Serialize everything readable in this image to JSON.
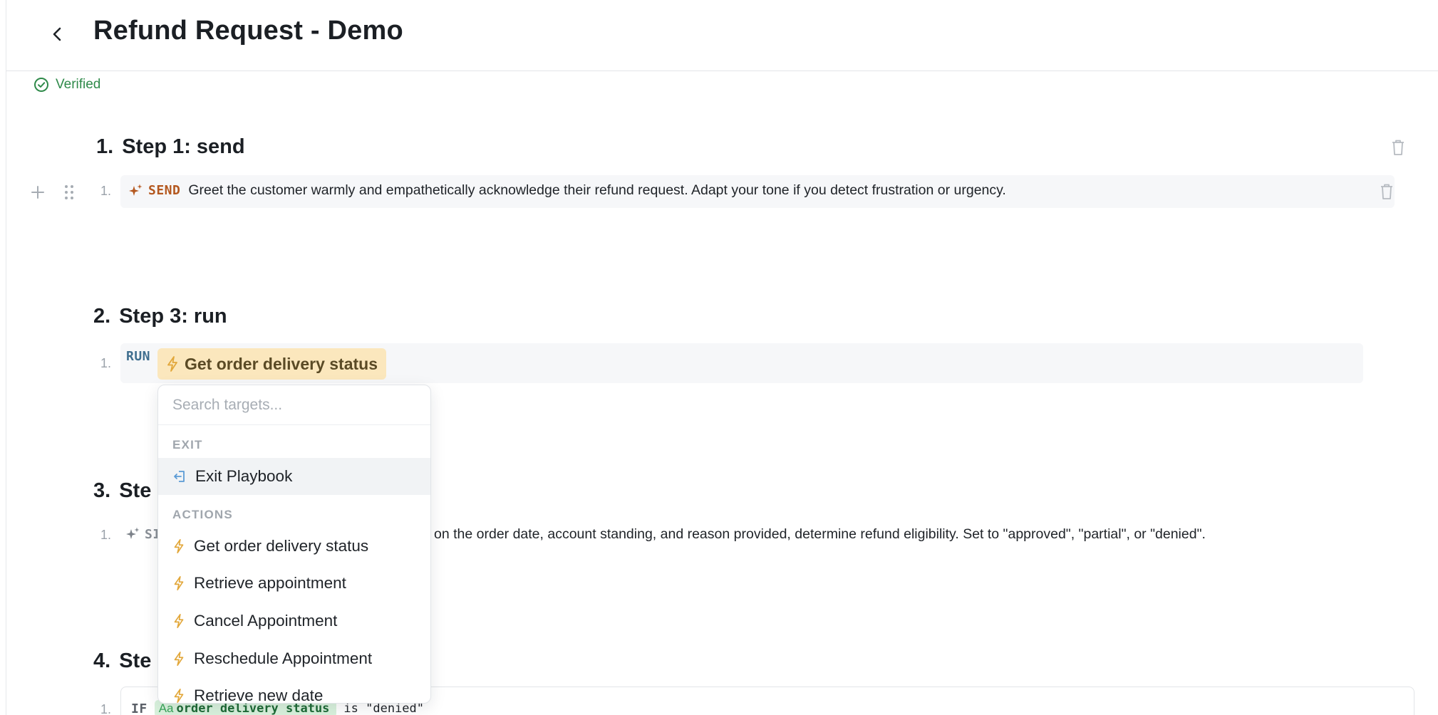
{
  "header": {
    "title": "Refund Request - Demo"
  },
  "status": {
    "label": "Verified"
  },
  "steps": [
    {
      "number": "1.",
      "title": "Step 1: send",
      "lines": [
        {
          "number": "1.",
          "keyword": "SEND",
          "text": "Greet the customer warmly and empathetically acknowledge their refund request. Adapt your tone if you detect frustration or urgency."
        }
      ]
    },
    {
      "number": "2.",
      "title": "Step 3: run",
      "lines": [
        {
          "number": "1.",
          "keyword": "RUN",
          "target": "Get order delivery status"
        }
      ]
    },
    {
      "number": "3.",
      "title_visible": "Ste",
      "lines": [
        {
          "number": "1.",
          "keyword_visible": "SI",
          "text_visible": "on the order date, account standing, and reason provided, determine refund eligibility. Set to \"approved\", \"partial\", or \"denied\"."
        }
      ]
    },
    {
      "number": "4.",
      "title_visible": "Ste",
      "lines": [
        {
          "number": "1.",
          "keyword": "IF",
          "variable_icon": "Aa",
          "variable": "order delivery status",
          "condition": "is \"denied\""
        }
      ]
    }
  ],
  "dropdown": {
    "search_placeholder": "Search targets...",
    "sections": [
      {
        "label": "EXIT",
        "items": [
          {
            "label": "Exit Playbook",
            "icon": "exit-icon",
            "active": true
          }
        ]
      },
      {
        "label": "ACTIONS",
        "items": [
          {
            "label": "Get order delivery status",
            "icon": "lightning-icon"
          },
          {
            "label": "Retrieve appointment",
            "icon": "lightning-icon"
          },
          {
            "label": "Cancel Appointment",
            "icon": "lightning-icon"
          },
          {
            "label": "Reschedule Appointment",
            "icon": "lightning-icon"
          },
          {
            "label": "Retrieve new date",
            "icon": "lightning-icon"
          }
        ]
      }
    ]
  },
  "colors": {
    "verified": "#2f8a4a",
    "send_keyword": "#b4581f",
    "run_keyword": "#3f6e8f",
    "run_chip_bg": "#fbe7bd",
    "lightning": "#e2a73a",
    "variable_chip_bg": "#d9f2dd",
    "exit_icon": "#5b9bd5"
  }
}
